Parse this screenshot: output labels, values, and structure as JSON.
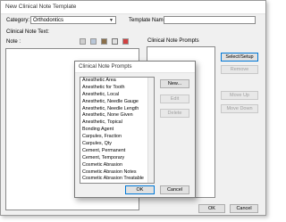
{
  "main_window": {
    "title": "New Clinical Note Template",
    "category_label": "Category:",
    "category_value": "Orthodontics",
    "template_name_label": "Template Name:",
    "template_name_value": "",
    "clinical_note_text_label": "Clinical Note Text:",
    "note_label": "Note :",
    "prompts_label": "Clinical Note Prompts",
    "buttons": {
      "select_setup": "Select/Setup",
      "remove": "Remove",
      "move_up": "Move Up",
      "move_down": "Move Down",
      "ok": "OK",
      "cancel": "Cancel"
    },
    "toolbar_icons": [
      "tools-icon",
      "copy-icon",
      "notes-icon",
      "spellcheck-icon",
      "insert-prompt-icon"
    ]
  },
  "prompts_dialog": {
    "title": "Clinical Note Prompts",
    "items": [
      "Anesthetic Area",
      "Anesthetic for Tooth",
      "Anesthetic, Local",
      "Anesthetic, Needle Gauge",
      "Anesthetic, Needle Length",
      "Anesthetic, None Given",
      "Anesthetic, Topical",
      "Bonding Agent",
      "Carpules, Fraction",
      "Carpules, Qty",
      "Cement, Permanent",
      "Cement, Temporary",
      "Cosmetic Abrasion",
      "Cosmetic Abrasion Notes",
      "Cosmetic Abrasion Treatable",
      "Cosmetic Area"
    ],
    "buttons": {
      "new": "New...",
      "edit": "Edit",
      "delete": "Delete",
      "ok": "OK",
      "cancel": "Cancel"
    }
  }
}
